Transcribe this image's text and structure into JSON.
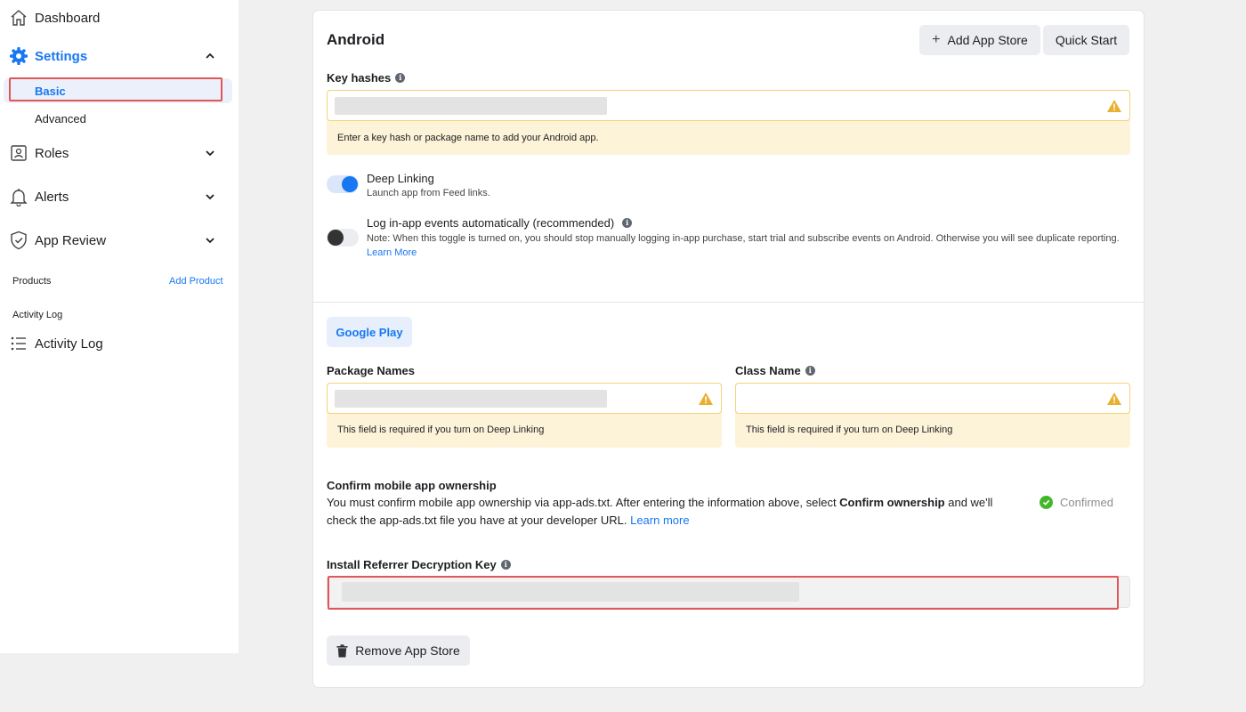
{
  "sidebar": {
    "dashboard": {
      "label": "Dashboard",
      "icon": "home-icon"
    },
    "settings": {
      "label": "Settings",
      "icon": "gear-icon"
    },
    "settings_children": [
      {
        "label": "Basic",
        "active": true
      },
      {
        "label": "Advanced",
        "active": false
      }
    ],
    "roles": {
      "label": "Roles",
      "icon": "id-badge-icon"
    },
    "alerts": {
      "label": "Alerts",
      "icon": "bell-icon"
    },
    "app_review": {
      "label": "App Review",
      "icon": "shield-check-icon"
    },
    "products_section": "Products",
    "add_product": "Add Product",
    "activity_section": "Activity Log",
    "activity_log": {
      "label": "Activity Log",
      "icon": "list-icon"
    }
  },
  "card": {
    "title": "Android",
    "add_app_store_label": "Add App Store",
    "quick_start_label": "Quick Start",
    "key_hashes": {
      "label": "Key hashes",
      "hint": "Enter a key hash or package name to add your Android app."
    },
    "deep_linking": {
      "title": "Deep Linking",
      "desc": "Launch app from Feed links.",
      "enabled": true
    },
    "log_events": {
      "title": "Log in-app events automatically (recommended)",
      "note": "Note: When this toggle is turned on, you should stop manually logging in-app purchase, start trial and subscribe events on Android. Otherwise you will see duplicate reporting.",
      "learn_more": "Learn More",
      "enabled": false
    },
    "store_tab": "Google Play",
    "package_names": {
      "label": "Package Names",
      "hint": "This field is required if you turn on Deep Linking"
    },
    "class_name": {
      "label": "Class Name",
      "hint": "This field is required if you turn on Deep Linking"
    },
    "confirm": {
      "title": "Confirm mobile app ownership",
      "desc_before": "You must confirm mobile app ownership via app-ads.txt. After entering the information above, select ",
      "desc_bold": "Confirm ownership",
      "desc_after": " and we'll check the app-ads.txt file you have at your developer URL. ",
      "learn_more": "Learn more",
      "status": "Confirmed"
    },
    "decryption_key": {
      "label": "Install Referrer Decryption Key"
    },
    "remove_label": "Remove App Store"
  },
  "colors": {
    "accent": "#1877f2",
    "highlight": "#e15659",
    "warning_bg": "#fdf3d8",
    "warning_icon": "#e8b02f",
    "confirmed": "#42b72a"
  }
}
